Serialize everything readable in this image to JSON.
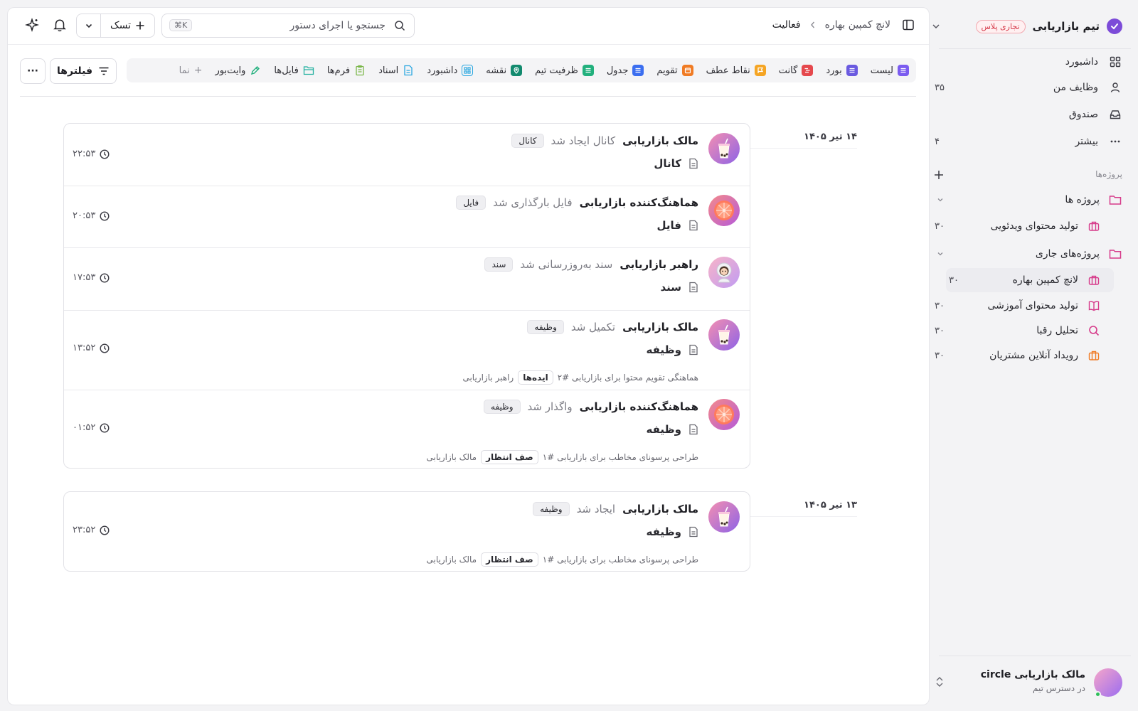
{
  "sidebar": {
    "workspace_name": "تیم بازاریابی",
    "workspace_badge": "تجاری پلاس",
    "nav": [
      {
        "label": "داشبورد",
        "count": "",
        "icon": "grid-icon"
      },
      {
        "label": "وظایف من",
        "count": "۳۵",
        "icon": "user-icon"
      },
      {
        "label": "صندوق",
        "count": "",
        "icon": "inbox-icon"
      },
      {
        "label": "بیشتر",
        "count": "۴",
        "icon": "more-icon"
      }
    ],
    "projects_heading": "پروژه‌ها",
    "folder_projects": "پروژه ها",
    "project_items": [
      {
        "label": "تولید محتوای ویدئویی",
        "count": "۳۰",
        "icon": "briefcase-icon"
      }
    ],
    "folder_current": "پروژه‌های جاری",
    "current_items": [
      {
        "label": "لانچ کمپین بهاره",
        "count": "۳۰",
        "icon": "briefcase-icon"
      },
      {
        "label": "تولید محتوای آموزشی",
        "count": "۳۰",
        "icon": "book-icon"
      },
      {
        "label": "تحلیل رقبا",
        "count": "۳۰",
        "icon": "search-icon"
      },
      {
        "label": "رویداد آنلاین مشتریان",
        "count": "۳۰",
        "icon": "briefcase-icon"
      }
    ],
    "profile_name": "مالک بازاریابی circle",
    "profile_status": "در دسترس تیم"
  },
  "topbar": {
    "breadcrumb_parent": "لانچ کمپین بهاره",
    "breadcrumb_current": "فعالیت",
    "search_placeholder": "جستجو یا اجرای دستور",
    "search_shortcut": "⌘K",
    "task_label": "تسک"
  },
  "views": [
    {
      "label": "لیست",
      "color": "#7b5cf0"
    },
    {
      "label": "بورد",
      "color": "#6a5ae0"
    },
    {
      "label": "گانت",
      "color": "#e5484d"
    },
    {
      "label": "نقاط عطف",
      "color": "#f5a524"
    },
    {
      "label": "تقویم",
      "color": "#f07b24"
    },
    {
      "label": "جدول",
      "color": "#3b6ef0"
    },
    {
      "label": "ظرفیت تیم",
      "color": "#22b07d"
    },
    {
      "label": "نقشه",
      "color": "#128a6e"
    },
    {
      "label": "داشبورد",
      "color": "#2aa7e0"
    },
    {
      "label": "اسناد",
      "color": "#2aa7e0"
    },
    {
      "label": "فرم‌ها",
      "color": "#7ab648"
    },
    {
      "label": "فایل‌ها",
      "color": "#22b0a0"
    },
    {
      "label": "وایت‌بور",
      "color": "#22b07d"
    }
  ],
  "views_add_label": "نما",
  "filters_label": "فیلترها",
  "more_label": "···",
  "activity": [
    {
      "date": "۱۴ تیر ۱۴۰۵",
      "entries": [
        {
          "who": "مالک بازاریابی",
          "action": "کانال ایجاد شد",
          "chip": "کانال",
          "object": "کانال",
          "time": "۲۲:۵۳",
          "context": "",
          "status": "",
          "person": ""
        },
        {
          "who": "هماهنگ‌کننده بازاریابی",
          "action": "فایل بارگذاری شد",
          "chip": "فایل",
          "object": "فایل",
          "time": "۲۰:۵۳",
          "context": "",
          "status": "",
          "person": ""
        },
        {
          "who": "راهبر بازاریابی",
          "action": "سند به‌روزرسانی شد",
          "chip": "سند",
          "object": "سند",
          "time": "۱۷:۵۳",
          "context": "",
          "status": "",
          "person": ""
        },
        {
          "who": "مالک بازاریابی",
          "action": "تکمیل شد",
          "chip": "وظیفه",
          "object": "وظیفه",
          "time": "۱۳:۵۲",
          "context": "هماهنگی تقویم محتوا برای بازاریابی #۲",
          "status": "ایده‌ها",
          "person": "راهبر بازاریابی"
        },
        {
          "who": "هماهنگ‌کننده بازاریابی",
          "action": "واگذار شد",
          "chip": "وظیفه",
          "object": "وظیفه",
          "time": "۰۱:۵۲",
          "context": "طراحی پرسونای مخاطب برای بازاریابی #۱",
          "status": "صف انتظار",
          "person": "مالک بازاریابی"
        }
      ]
    },
    {
      "date": "۱۳ تیر ۱۴۰۵",
      "entries": [
        {
          "who": "مالک بازاریابی",
          "action": "ایجاد شد",
          "chip": "وظیفه",
          "object": "وظیفه",
          "time": "۲۳:۵۲",
          "context": "طراحی پرسونای مخاطب برای بازاریابی #۱",
          "status": "صف انتظار",
          "person": "مالک بازاریابی"
        }
      ]
    }
  ]
}
